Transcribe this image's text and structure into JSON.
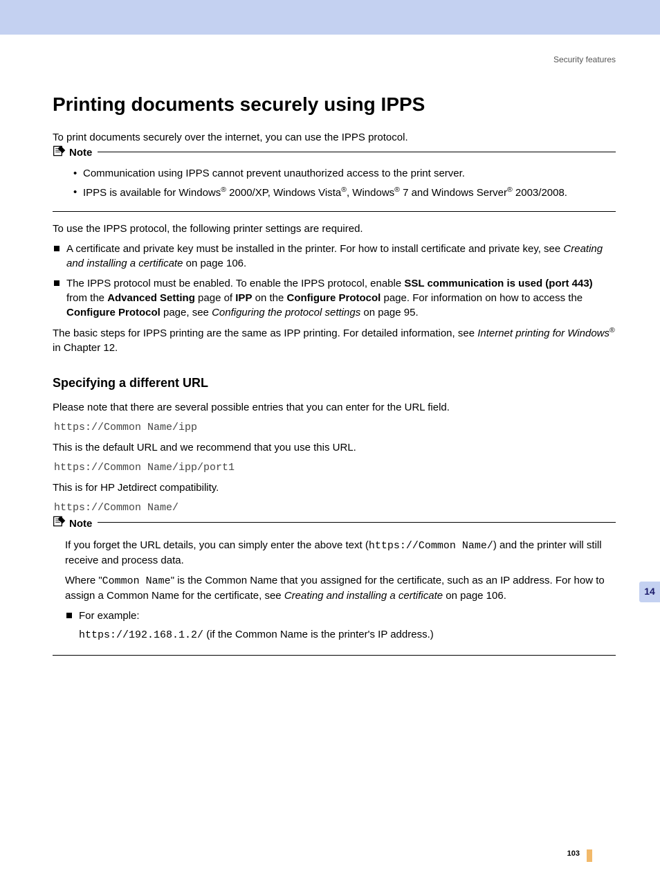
{
  "header": {
    "section": "Security features"
  },
  "h1": "Printing documents securely using IPPS",
  "intro": "To print documents securely over the internet, you can use the IPPS protocol.",
  "noteLabel": "Note",
  "note1": {
    "b1": "Communication using IPPS cannot prevent unauthorized access to the print server.",
    "b2a": "IPPS is available for Windows",
    "b2b": " 2000/XP, Windows Vista",
    "b2c": ", Windows",
    "b2d": " 7 and Windows Server",
    "b2e": " 2003/2008."
  },
  "para2": "To use the IPPS protocol, the following printer settings are required.",
  "sq1": {
    "a": "A certificate and private key must be installed in the printer. For how to install certificate and private key, see ",
    "link": "Creating and installing a certificate",
    "b": " on page 106."
  },
  "sq2": {
    "a": "The IPPS protocol must be enabled. To enable the IPPS protocol, enable ",
    "bold1": "SSL communication is used (port 443)",
    "b": " from the ",
    "bold2": "Advanced Setting",
    "c": " page of ",
    "bold3": "IPP",
    "d": " on the ",
    "bold4": "Configure Protocol",
    "e": " page. For information on how to access the ",
    "bold5": "Configure Protocol",
    "f": " page, see ",
    "link": "Configuring the protocol settings",
    "g": " on page 95."
  },
  "para3": {
    "a": "The basic steps for IPPS printing are the same as IPP printing. For detailed information, see ",
    "link": "Internet printing for Windows",
    "b": " in Chapter 12."
  },
  "h2": "Specifying a different URL",
  "para4": "Please note that there are several possible entries that you can enter for the URL field.",
  "code1": "https://Common Name/ipp",
  "para5": "This is the default URL and we recommend that you use this URL.",
  "code2": "https://Common Name/ipp/port1",
  "para6": "This is for HP Jetdirect compatibility.",
  "code3": "https://Common Name/",
  "note2": {
    "p1a": "If you forget the URL details, you can simply enter the above text (",
    "p1code": "https://Common Name/",
    "p1b": ") and the printer will still receive and process data.",
    "p2a": "Where \"",
    "p2code": "Common Name",
    "p2b": "\" is the Common Name that you assigned for the certificate, such as an IP address. For how to assign a Common Name for the certificate, see ",
    "p2link": "Creating and installing a certificate",
    "p2c": " on page 106.",
    "sq": "For example:",
    "excode": "https://192.168.1.2/",
    "exrest": " (if the Common Name is the printer's IP address.)"
  },
  "chapter": "14",
  "pageNum": "103",
  "reg": "®"
}
